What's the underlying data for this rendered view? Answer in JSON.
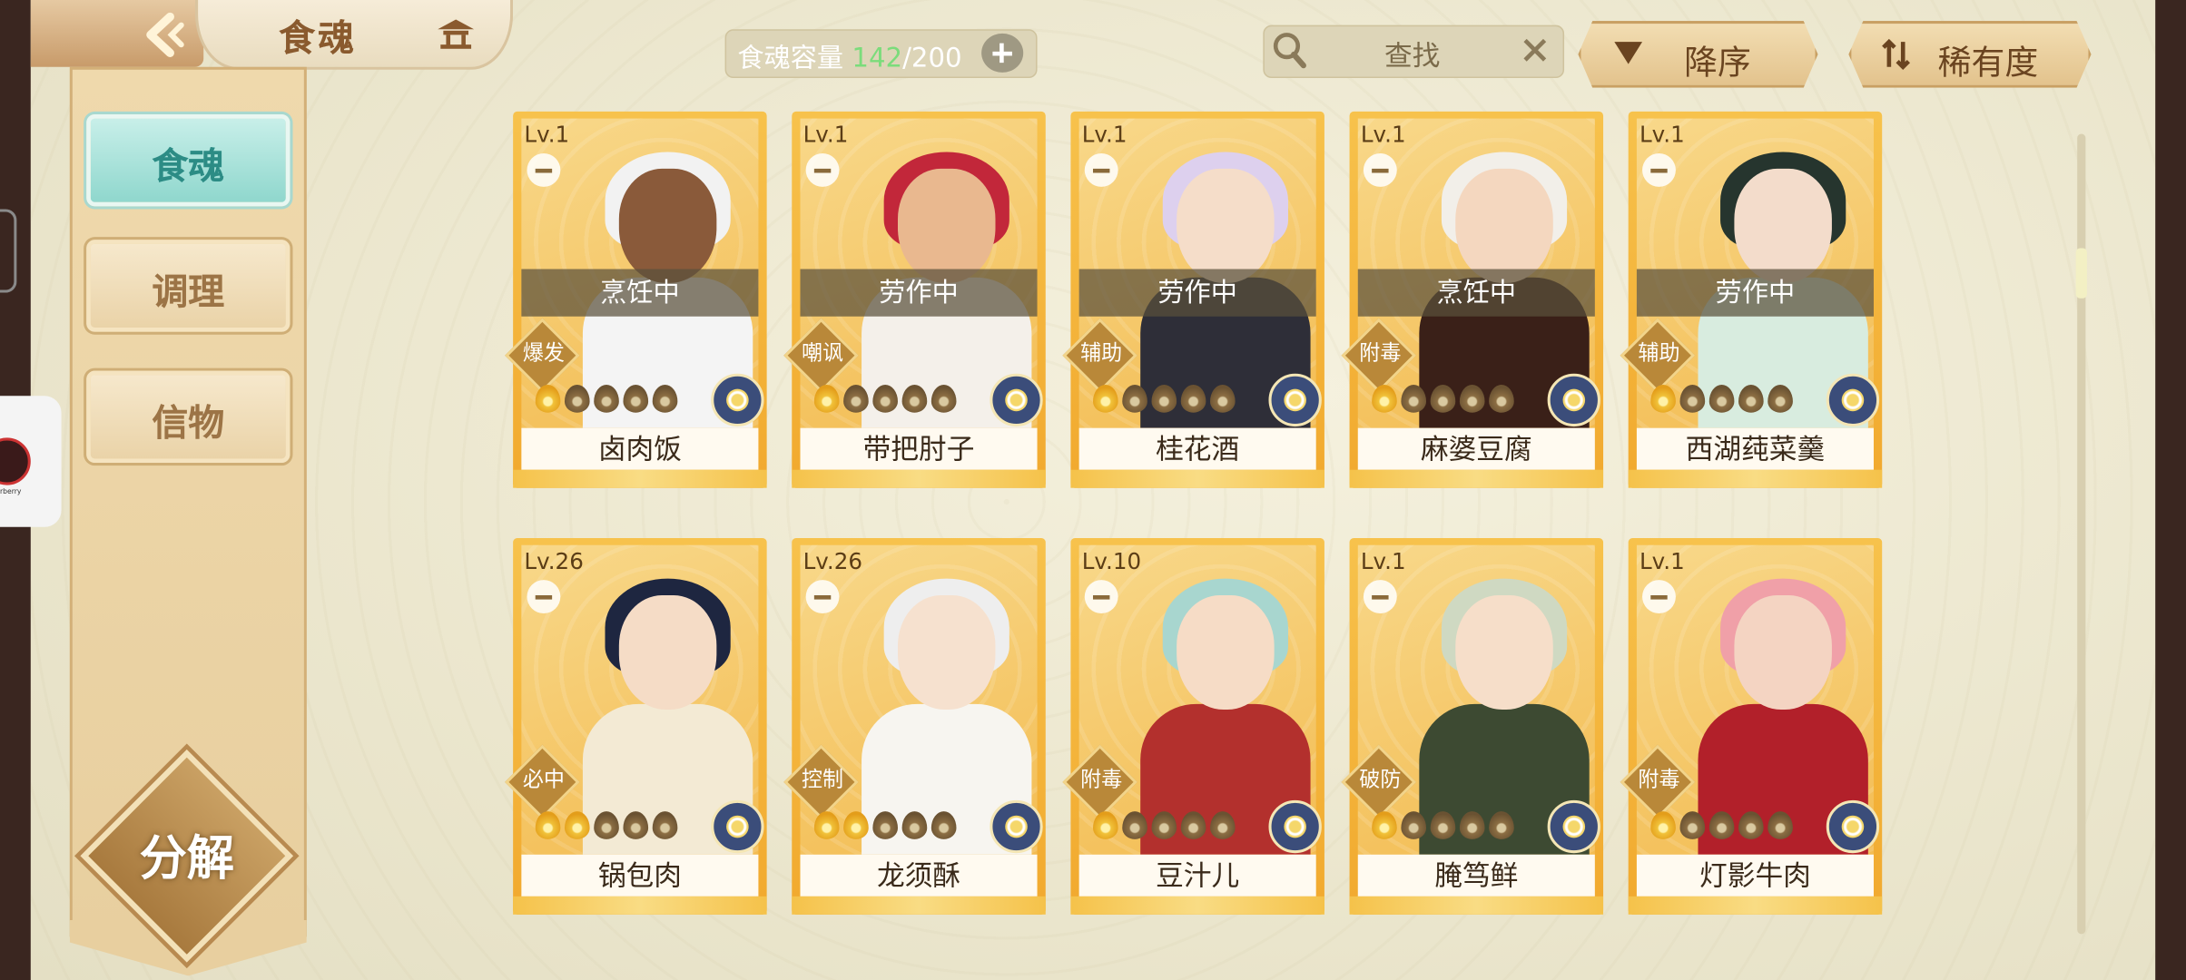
{
  "header": {
    "title": "食魂",
    "capacity_label": "食魂容量",
    "capacity_current": "142",
    "capacity_total": "/200",
    "search_placeholder": "查找",
    "sort_order_label": "降序",
    "sort_by_label": "稀有度"
  },
  "sidebar": {
    "items": [
      {
        "label": "食魂",
        "active": true
      },
      {
        "label": "调理",
        "active": false
      },
      {
        "label": "信物",
        "active": false
      }
    ],
    "decompose_label": "分解"
  },
  "colors": {
    "accent_teal": "#8fd7cd",
    "card_gold": "#f1a92e",
    "capacity_green": "#7bdc7b",
    "panel_bg": "#ebe6cd"
  },
  "cards": [
    {
      "level": "Lv.1",
      "status": "烹饪中",
      "tag": "爆发",
      "stars": 1,
      "name": "卤肉饭",
      "hair": "#f2f2f2",
      "skin": "#8a5a3a",
      "outfit": "#f4f4f4"
    },
    {
      "level": "Lv.1",
      "status": "劳作中",
      "tag": "嘲讽",
      "stars": 1,
      "name": "带把肘子",
      "hair": "#c2273a",
      "skin": "#e9b88f",
      "outfit": "#f4f0ea"
    },
    {
      "level": "Lv.1",
      "status": "劳作中",
      "tag": "辅助",
      "stars": 1,
      "name": "桂花酒",
      "hair": "#ddd0ee",
      "skin": "#f5ddc9",
      "outfit": "#2e2e38"
    },
    {
      "level": "Lv.1",
      "status": "烹饪中",
      "tag": "附毒",
      "stars": 1,
      "name": "麻婆豆腐",
      "hair": "#f2efe9",
      "skin": "#f4d7bf",
      "outfit": "#3a2018"
    },
    {
      "level": "Lv.1",
      "status": "劳作中",
      "tag": "辅助",
      "stars": 1,
      "name": "西湖莼菜羹",
      "hair": "#26352e",
      "skin": "#f3dccb",
      "outfit": "#d8ecdf"
    },
    {
      "level": "Lv.26",
      "status": "",
      "tag": "必中",
      "stars": 2,
      "name": "锅包肉",
      "hair": "#1e2640",
      "skin": "#f5dcc6",
      "outfit": "#f3ead4"
    },
    {
      "level": "Lv.26",
      "status": "",
      "tag": "控制",
      "stars": 2,
      "name": "龙须酥",
      "hair": "#eeeeee",
      "skin": "#f6e1cf",
      "outfit": "#f7f5f0"
    },
    {
      "level": "Lv.10",
      "status": "",
      "tag": "附毒",
      "stars": 1,
      "name": "豆汁儿",
      "hair": "#a8d6cf",
      "skin": "#f6dcc6",
      "outfit": "#b3302d"
    },
    {
      "level": "Lv.1",
      "status": "",
      "tag": "破防",
      "stars": 1,
      "name": "腌笃鲜",
      "hair": "#cfd9c2",
      "skin": "#f6dec9",
      "outfit": "#3d4a32"
    },
    {
      "level": "Lv.1",
      "status": "",
      "tag": "附毒",
      "stars": 1,
      "name": "灯影牛肉",
      "hair": "#f0a0a8",
      "skin": "#f4d4c2",
      "outfit": "#b2202a"
    }
  ]
}
